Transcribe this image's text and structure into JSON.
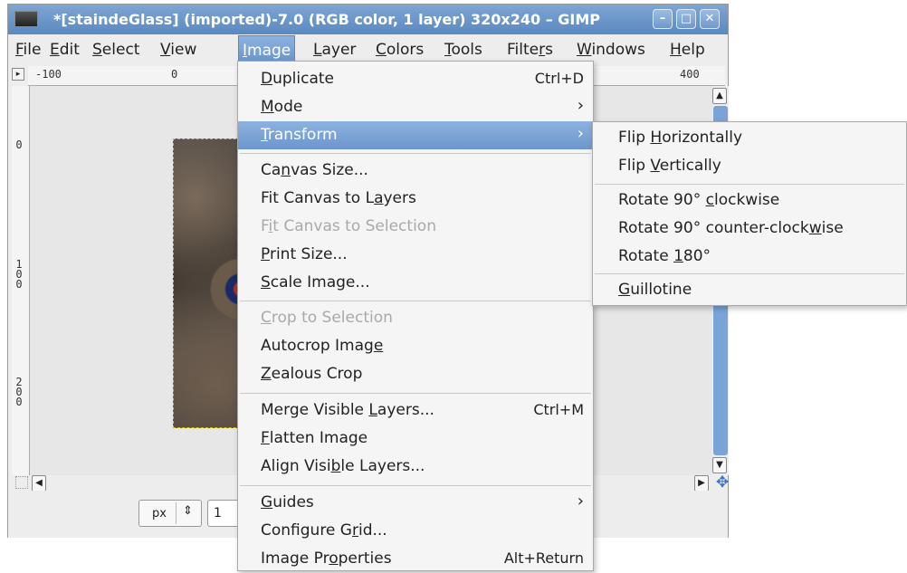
{
  "window": {
    "title": "*[staindeGlass] (imported)-7.0 (RGB color, 1 layer) 320x240 – GIMP",
    "buttons": [
      "–",
      "□",
      "✕"
    ]
  },
  "menubar": {
    "items": [
      {
        "name": "File",
        "pre": "",
        "ul": "F",
        "post": "ile"
      },
      {
        "name": "Edit",
        "pre": "",
        "ul": "E",
        "post": "dit"
      },
      {
        "name": "Select",
        "pre": "",
        "ul": "S",
        "post": "elect"
      },
      {
        "name": "View",
        "pre": "",
        "ul": "V",
        "post": "iew"
      },
      {
        "name": "Image",
        "pre": "",
        "ul": "I",
        "post": "mage"
      },
      {
        "name": "Layer",
        "pre": "",
        "ul": "L",
        "post": "ayer"
      },
      {
        "name": "Colors",
        "pre": "",
        "ul": "C",
        "post": "olors"
      },
      {
        "name": "Tools",
        "pre": "",
        "ul": "T",
        "post": "ools"
      },
      {
        "name": "Filters",
        "pre": "Filte",
        "ul": "r",
        "post": "s"
      },
      {
        "name": "Windows",
        "pre": "",
        "ul": "W",
        "post": "indows"
      },
      {
        "name": "Help",
        "pre": "",
        "ul": "H",
        "post": "elp"
      }
    ]
  },
  "ruler": {
    "h_labels": [
      "-100",
      "0",
      "400"
    ],
    "v_labels": [
      "0",
      "100",
      "200"
    ]
  },
  "statusbar": {
    "unit": "px",
    "zoom": "1"
  },
  "image_menu": {
    "items": [
      {
        "pre": "",
        "ul": "D",
        "post": "uplicate",
        "accel": "Ctrl+D"
      },
      {
        "pre": "",
        "ul": "M",
        "post": "ode",
        "submenu": true
      },
      {
        "pre": "",
        "ul": "T",
        "post": "ransform",
        "submenu": true,
        "highlight": true
      },
      {
        "pre": "Ca",
        "ul": "n",
        "post": "vas Size..."
      },
      {
        "pre": "Fit Canvas to L",
        "ul": "a",
        "post": "yers"
      },
      {
        "pre": "F",
        "ul": "i",
        "post": "t Canvas to Selection",
        "disabled": true
      },
      {
        "pre": "",
        "ul": "P",
        "post": "rint Size..."
      },
      {
        "pre": "",
        "ul": "S",
        "post": "cale Image..."
      },
      {
        "pre": "",
        "ul": "C",
        "post": "rop to Selection",
        "disabled": true
      },
      {
        "pre": "Autocrop Imag",
        "ul": "e",
        "post": ""
      },
      {
        "pre": "",
        "ul": "Z",
        "post": "ealous Crop"
      },
      {
        "pre": "Merge Visible ",
        "ul": "L",
        "post": "ayers...",
        "accel": "Ctrl+M"
      },
      {
        "pre": "",
        "ul": "F",
        "post": "latten Image"
      },
      {
        "pre": "Align Visi",
        "ul": "b",
        "post": "le Layers..."
      },
      {
        "pre": "",
        "ul": "G",
        "post": "uides",
        "submenu": true
      },
      {
        "pre": "Configure G",
        "ul": "r",
        "post": "id..."
      },
      {
        "pre": "Image Pr",
        "ul": "o",
        "post": "perties",
        "accel": "Alt+Return"
      }
    ]
  },
  "transform_menu": {
    "items": [
      {
        "pre": "Flip ",
        "ul": "H",
        "post": "orizontally"
      },
      {
        "pre": "Flip ",
        "ul": "V",
        "post": "ertically"
      },
      {
        "pre": "Rotate 90° ",
        "ul": "c",
        "post": "lockwise"
      },
      {
        "pre": "Rotate 90° counter-clock",
        "ul": "w",
        "post": "ise"
      },
      {
        "pre": "Rotate ",
        "ul": "1",
        "post": "80°"
      },
      {
        "pre": "",
        "ul": "G",
        "post": "uillotine"
      }
    ]
  },
  "colors": {
    "highlight": "#7aa3d8",
    "disabled": "#a9a9a9",
    "titlebar": "#6b96cc",
    "selection_border": "#d8c200"
  }
}
